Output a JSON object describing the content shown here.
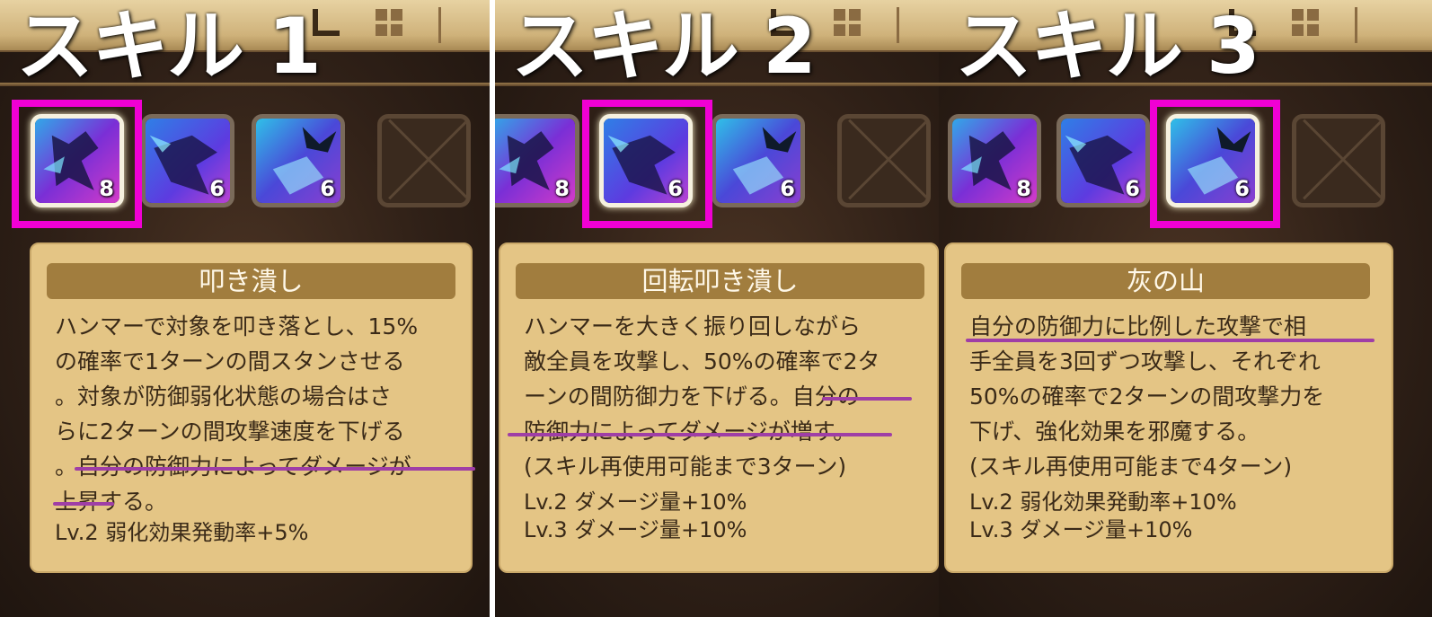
{
  "panels": [
    {
      "heading": "スキル 1",
      "slot_levels": [
        "8",
        "6",
        "6"
      ],
      "selected_slot": 1,
      "skill_name": "叩き潰し",
      "description": "ハンマーで対象を叩き落とし、15%\nの確率で1ターンの間スタンさせる\n。対象が防御弱化状態の場合はさ\nらに2ターンの間攻撃速度を下げる\n。自分の防御力によってダメージが\n上昇する。",
      "levels": [
        "Lv.2 弱化効果発動率+5%"
      ]
    },
    {
      "heading": "スキル 2",
      "slot_levels": [
        "8",
        "6",
        "6"
      ],
      "selected_slot": 2,
      "skill_name": "回転叩き潰し",
      "description": "ハンマーを大きく振り回しながら\n敵全員を攻撃し、50%の確率で2タ\nーンの間防御力を下げる。自分の\n防御力によってダメージが増す。\n(スキル再使用可能まで3ターン)",
      "levels": [
        "Lv.2 ダメージ量+10%",
        "Lv.3 ダメージ量+10%"
      ]
    },
    {
      "heading": "スキル 3",
      "slot_levels": [
        "8",
        "6",
        "6"
      ],
      "selected_slot": 3,
      "skill_name": "灰の山",
      "description": "自分の防御力に比例した攻撃で相\n手全員を3回ずつ攻撃し、それぞれ\n50%の確率で2ターンの間攻撃力を\n下げ、強化効果を邪魔する。\n(スキル再使用可能まで4ターン)",
      "levels": [
        "Lv.2 弱化効果発動率+10%",
        "Lv.3 ダメージ量+10%"
      ]
    }
  ],
  "colors": {
    "highlight": "#f000d4",
    "underline": "#9f3ea6",
    "card": "#e4c585",
    "title_bar": "#a17d3e"
  },
  "icons": [
    "skill-1-hammer-smash-icon",
    "skill-2-spin-smash-icon",
    "skill-3-ash-mountain-icon",
    "empty-slot-icon"
  ]
}
